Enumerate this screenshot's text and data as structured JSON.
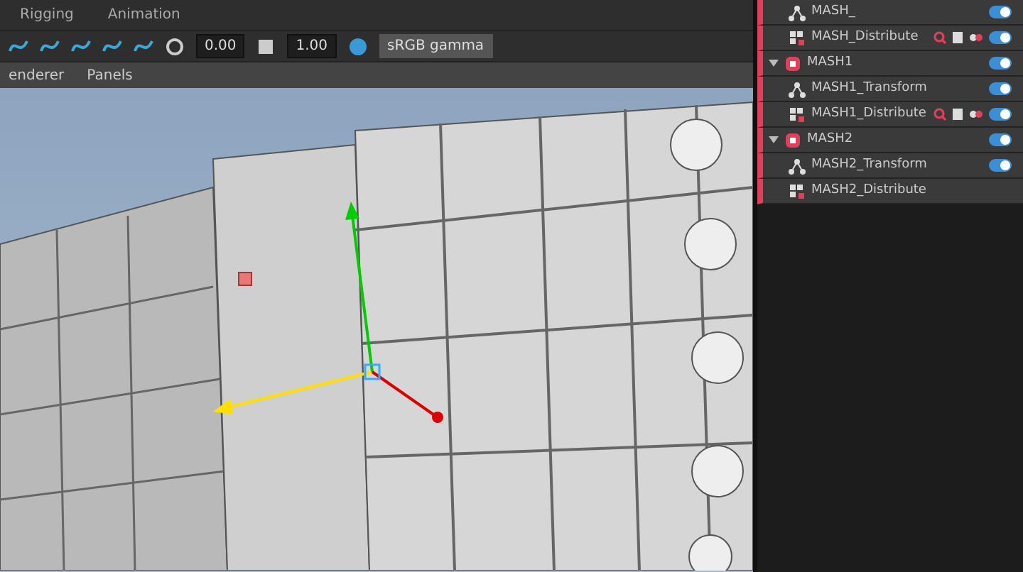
{
  "shelf_tabs": [
    {
      "label": "Rigging",
      "selected": false
    },
    {
      "label": "Animation",
      "selected": false
    }
  ],
  "toolbar": {
    "exposure": "0.00",
    "gamma": "1.00",
    "color_space": "sRGB gamma"
  },
  "panel_menu": [
    "enderer",
    "Panels"
  ],
  "outliner": [
    {
      "label": "MASH_",
      "kind": "transform",
      "enabled": true
    },
    {
      "label": "MASH_Distribute",
      "kind": "distribute",
      "enabled": true,
      "actions": true
    },
    {
      "label": "MASH1",
      "kind": "mash",
      "enabled": true,
      "expanded": true,
      "children": [
        {
          "label": "MASH1_Transform",
          "kind": "transform",
          "enabled": true
        },
        {
          "label": "MASH1_Distribute",
          "kind": "distribute",
          "enabled": true,
          "actions": true
        }
      ]
    },
    {
      "label": "MASH2",
      "kind": "mash",
      "enabled": true,
      "expanded": true,
      "children": [
        {
          "label": "MASH2_Transform",
          "kind": "transform",
          "enabled": true
        },
        {
          "label": "MASH2_Distribute",
          "kind": "distribute"
        }
      ]
    }
  ]
}
